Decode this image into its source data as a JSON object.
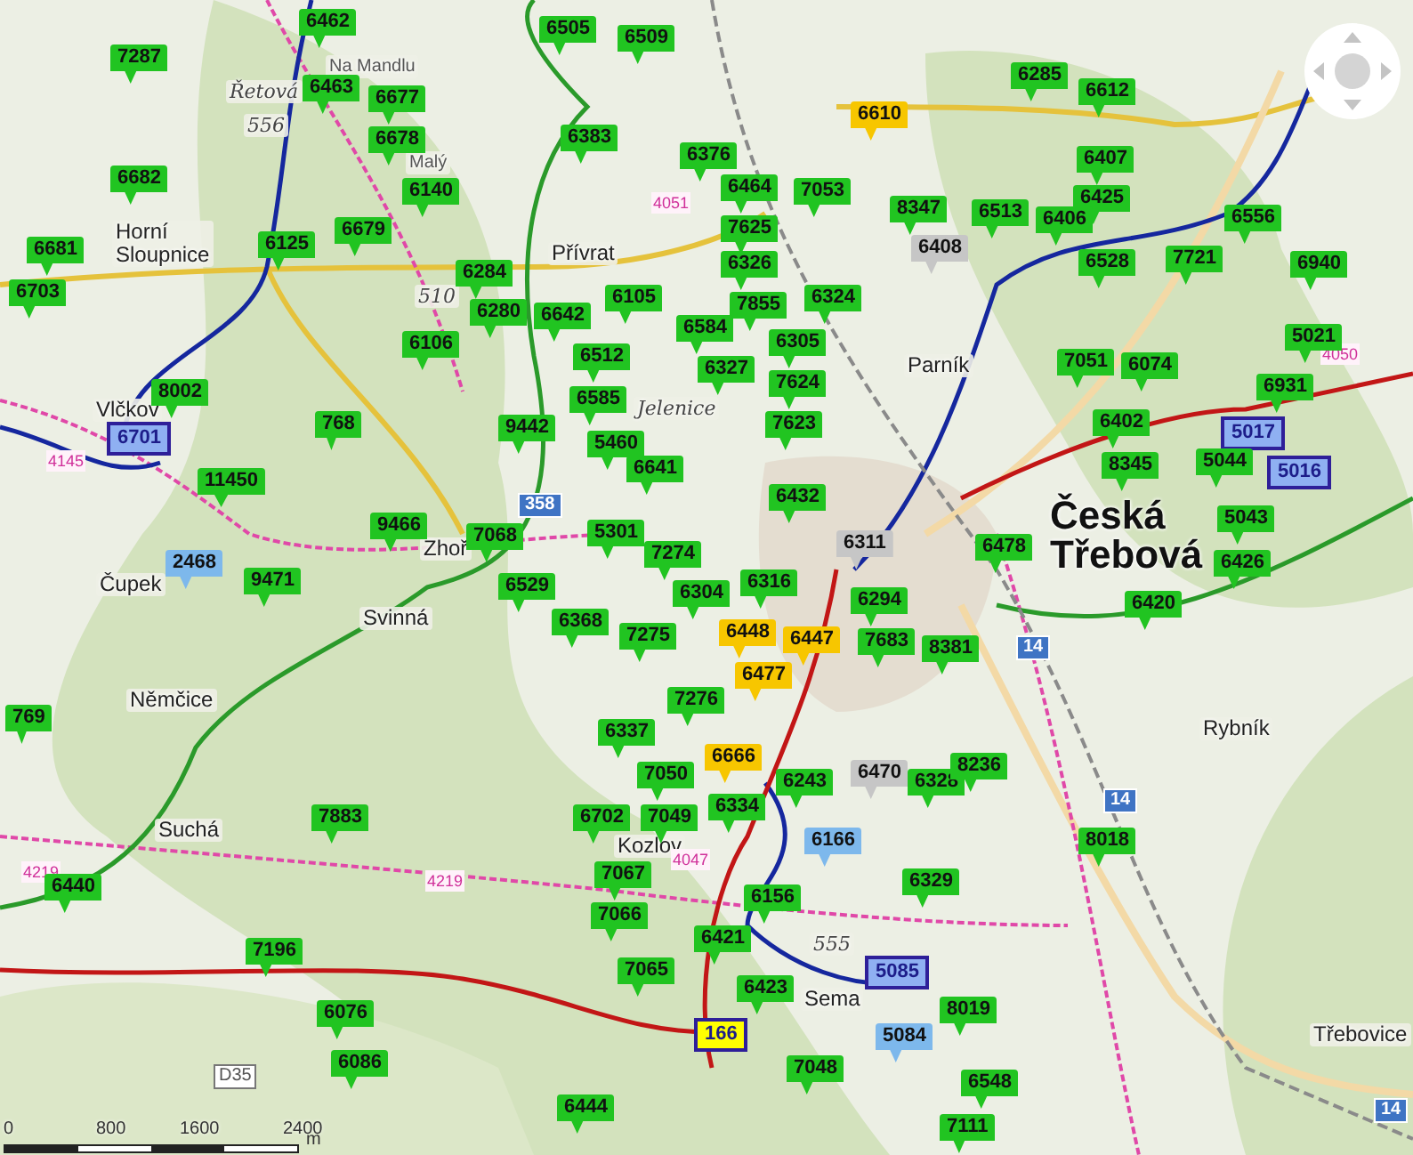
{
  "map": {
    "markers": [
      {
        "label": "6462",
        "color": "#21c421",
        "kind": "pin"
      },
      {
        "label": "7287",
        "color": "#21c421",
        "kind": "pin"
      },
      {
        "label": "6463",
        "color": "#21c421",
        "kind": "pin"
      },
      {
        "label": "6677",
        "color": "#21c421",
        "kind": "pin"
      },
      {
        "label": "6678",
        "color": "#21c421",
        "kind": "pin"
      },
      {
        "label": "6682",
        "color": "#21c421",
        "kind": "pin"
      },
      {
        "label": "6140",
        "color": "#21c421",
        "kind": "pin"
      },
      {
        "label": "6679",
        "color": "#21c421",
        "kind": "pin"
      },
      {
        "label": "6681",
        "color": "#21c421",
        "kind": "pin"
      },
      {
        "label": "6125",
        "color": "#21c421",
        "kind": "pin"
      },
      {
        "label": "6703",
        "color": "#21c421",
        "kind": "pin"
      },
      {
        "label": "6284",
        "color": "#21c421",
        "kind": "pin"
      },
      {
        "label": "6280",
        "color": "#21c421",
        "kind": "pin"
      },
      {
        "label": "6106",
        "color": "#21c421",
        "kind": "pin"
      },
      {
        "label": "8002",
        "color": "#21c421",
        "kind": "pin"
      },
      {
        "label": "6701",
        "color": "#8fb0f2",
        "kind": "framed"
      },
      {
        "label": "768",
        "color": "#21c421",
        "kind": "pin"
      },
      {
        "label": "11450",
        "color": "#21c421",
        "kind": "pin"
      },
      {
        "label": "9466",
        "color": "#21c421",
        "kind": "pin"
      },
      {
        "label": "2468",
        "color": "#7db8ec",
        "kind": "pin"
      },
      {
        "label": "9471",
        "color": "#21c421",
        "kind": "pin"
      },
      {
        "label": "6505",
        "color": "#21c421",
        "kind": "pin"
      },
      {
        "label": "6509",
        "color": "#21c421",
        "kind": "pin"
      },
      {
        "label": "6383",
        "color": "#21c421",
        "kind": "pin"
      },
      {
        "label": "6376",
        "color": "#21c421",
        "kind": "pin"
      },
      {
        "label": "6464",
        "color": "#21c421",
        "kind": "pin"
      },
      {
        "label": "7053",
        "color": "#21c421",
        "kind": "pin"
      },
      {
        "label": "7625",
        "color": "#21c421",
        "kind": "pin"
      },
      {
        "label": "6326",
        "color": "#21c421",
        "kind": "pin"
      },
      {
        "label": "7855",
        "color": "#21c421",
        "kind": "pin"
      },
      {
        "label": "6105",
        "color": "#21c421",
        "kind": "pin"
      },
      {
        "label": "6324",
        "color": "#21c421",
        "kind": "pin"
      },
      {
        "label": "6642",
        "color": "#21c421",
        "kind": "pin"
      },
      {
        "label": "6584",
        "color": "#21c421",
        "kind": "pin"
      },
      {
        "label": "6305",
        "color": "#21c421",
        "kind": "pin"
      },
      {
        "label": "6512",
        "color": "#21c421",
        "kind": "pin"
      },
      {
        "label": "6327",
        "color": "#21c421",
        "kind": "pin"
      },
      {
        "label": "7624",
        "color": "#21c421",
        "kind": "pin"
      },
      {
        "label": "7623",
        "color": "#21c421",
        "kind": "pin"
      },
      {
        "label": "6585",
        "color": "#21c421",
        "kind": "pin"
      },
      {
        "label": "9442",
        "color": "#21c421",
        "kind": "pin"
      },
      {
        "label": "5460",
        "color": "#21c421",
        "kind": "pin"
      },
      {
        "label": "6641",
        "color": "#21c421",
        "kind": "pin"
      },
      {
        "label": "6432",
        "color": "#21c421",
        "kind": "pin"
      },
      {
        "label": "7068",
        "color": "#21c421",
        "kind": "pin"
      },
      {
        "label": "5301",
        "color": "#21c421",
        "kind": "pin"
      },
      {
        "label": "6311",
        "color": "#c6c6c6",
        "kind": "pin"
      },
      {
        "label": "7274",
        "color": "#21c421",
        "kind": "pin"
      },
      {
        "label": "6529",
        "color": "#21c421",
        "kind": "pin"
      },
      {
        "label": "6304",
        "color": "#21c421",
        "kind": "pin"
      },
      {
        "label": "6316",
        "color": "#21c421",
        "kind": "pin"
      },
      {
        "label": "6368",
        "color": "#21c421",
        "kind": "pin"
      },
      {
        "label": "7275",
        "color": "#21c421",
        "kind": "pin"
      },
      {
        "label": "6448",
        "color": "#f7c600",
        "kind": "pin"
      },
      {
        "label": "6447",
        "color": "#f7c600",
        "kind": "pin"
      },
      {
        "label": "6294",
        "color": "#21c421",
        "kind": "pin"
      },
      {
        "label": "7683",
        "color": "#21c421",
        "kind": "pin"
      },
      {
        "label": "6477",
        "color": "#f7c600",
        "kind": "pin"
      },
      {
        "label": "7276",
        "color": "#21c421",
        "kind": "pin"
      },
      {
        "label": "8381",
        "color": "#21c421",
        "kind": "pin"
      },
      {
        "label": "6337",
        "color": "#21c421",
        "kind": "pin"
      },
      {
        "label": "7050",
        "color": "#21c421",
        "kind": "pin"
      },
      {
        "label": "6666",
        "color": "#f7c600",
        "kind": "pin"
      },
      {
        "label": "6702",
        "color": "#21c421",
        "kind": "pin"
      },
      {
        "label": "7049",
        "color": "#21c421",
        "kind": "pin"
      },
      {
        "label": "6334",
        "color": "#21c421",
        "kind": "pin"
      },
      {
        "label": "6243",
        "color": "#21c421",
        "kind": "pin"
      },
      {
        "label": "6470",
        "color": "#c6c6c6",
        "kind": "pin"
      },
      {
        "label": "6328",
        "color": "#21c421",
        "kind": "pin"
      },
      {
        "label": "6166",
        "color": "#7db8ec",
        "kind": "pin"
      },
      {
        "label": "7067",
        "color": "#21c421",
        "kind": "pin"
      },
      {
        "label": "6329",
        "color": "#21c421",
        "kind": "pin"
      },
      {
        "label": "6156",
        "color": "#21c421",
        "kind": "pin"
      },
      {
        "label": "7066",
        "color": "#21c421",
        "kind": "pin"
      },
      {
        "label": "6421",
        "color": "#21c421",
        "kind": "pin"
      },
      {
        "label": "7065",
        "color": "#21c421",
        "kind": "pin"
      },
      {
        "label": "5085",
        "color": "#8fb0f2",
        "kind": "framed"
      },
      {
        "label": "6423",
        "color": "#21c421",
        "kind": "pin"
      },
      {
        "label": "166",
        "color": "#ffff00",
        "kind": "framed"
      },
      {
        "label": "5084",
        "color": "#7db8ec",
        "kind": "pin"
      },
      {
        "label": "8019",
        "color": "#21c421",
        "kind": "pin"
      },
      {
        "label": "7048",
        "color": "#21c421",
        "kind": "pin"
      },
      {
        "label": "6444",
        "color": "#21c421",
        "kind": "pin"
      },
      {
        "label": "6548",
        "color": "#21c421",
        "kind": "pin"
      },
      {
        "label": "7111",
        "color": "#21c421",
        "kind": "pin"
      },
      {
        "label": "6610",
        "color": "#f7c600",
        "kind": "pin"
      },
      {
        "label": "6285",
        "color": "#21c421",
        "kind": "pin"
      },
      {
        "label": "6612",
        "color": "#21c421",
        "kind": "pin"
      },
      {
        "label": "6407",
        "color": "#21c421",
        "kind": "pin"
      },
      {
        "label": "6425",
        "color": "#21c421",
        "kind": "pin"
      },
      {
        "label": "8347",
        "color": "#21c421",
        "kind": "pin"
      },
      {
        "label": "6408",
        "color": "#c6c6c6",
        "kind": "pin"
      },
      {
        "label": "6513",
        "color": "#21c421",
        "kind": "pin"
      },
      {
        "label": "6406",
        "color": "#21c421",
        "kind": "pin"
      },
      {
        "label": "6556",
        "color": "#21c421",
        "kind": "pin"
      },
      {
        "label": "6528",
        "color": "#21c421",
        "kind": "pin"
      },
      {
        "label": "7721",
        "color": "#21c421",
        "kind": "pin"
      },
      {
        "label": "6940",
        "color": "#21c421",
        "kind": "pin"
      },
      {
        "label": "5021",
        "color": "#21c421",
        "kind": "pin"
      },
      {
        "label": "7051",
        "color": "#21c421",
        "kind": "pin"
      },
      {
        "label": "6074",
        "color": "#21c421",
        "kind": "pin"
      },
      {
        "label": "6931",
        "color": "#21c421",
        "kind": "pin"
      },
      {
        "label": "6402",
        "color": "#21c421",
        "kind": "pin"
      },
      {
        "label": "5017",
        "color": "#8fb0f2",
        "kind": "framed"
      },
      {
        "label": "5044",
        "color": "#21c421",
        "kind": "pin"
      },
      {
        "label": "5016",
        "color": "#8fb0f2",
        "kind": "framed"
      },
      {
        "label": "8345",
        "color": "#21c421",
        "kind": "pin"
      },
      {
        "label": "5043",
        "color": "#21c421",
        "kind": "pin"
      },
      {
        "label": "6420",
        "color": "#21c421",
        "kind": "pin"
      },
      {
        "label": "6426",
        "color": "#21c421",
        "kind": "pin"
      },
      {
        "label": "6478",
        "color": "#21c421",
        "kind": "pin"
      },
      {
        "label": "8236",
        "color": "#21c421",
        "kind": "pin"
      },
      {
        "label": "8018",
        "color": "#21c421",
        "kind": "pin"
      },
      {
        "label": "769",
        "color": "#21c421",
        "kind": "pin"
      },
      {
        "label": "7883",
        "color": "#21c421",
        "kind": "pin"
      },
      {
        "label": "6440",
        "color": "#21c421",
        "kind": "pin"
      },
      {
        "label": "7196",
        "color": "#21c421",
        "kind": "pin"
      },
      {
        "label": "6076",
        "color": "#21c421",
        "kind": "pin"
      },
      {
        "label": "6086",
        "color": "#21c421",
        "kind": "pin"
      }
    ],
    "places": [
      {
        "name": "Řetová",
        "kind": "peak"
      },
      {
        "name": "556",
        "kind": "peak"
      },
      {
        "name": "Na Mandlu",
        "kind": "locality"
      },
      {
        "name": "Horní Sloupnice",
        "kind": "village"
      },
      {
        "name": "Malý",
        "kind": "locality"
      },
      {
        "name": "510",
        "kind": "peak"
      },
      {
        "name": "Přívrat",
        "kind": "village"
      },
      {
        "name": "Jelenice",
        "kind": "peak"
      },
      {
        "name": "Parník",
        "kind": "village"
      },
      {
        "name": "Vlčkov",
        "kind": "village"
      },
      {
        "name": "Zhoř",
        "kind": "village"
      },
      {
        "name": "Čupek",
        "kind": "village"
      },
      {
        "name": "Svinná",
        "kind": "village"
      },
      {
        "name": "Němčice",
        "kind": "village"
      },
      {
        "name": "Suchá",
        "kind": "village"
      },
      {
        "name": "Kozlov",
        "kind": "village"
      },
      {
        "name": "555",
        "kind": "peak"
      },
      {
        "name": "Sema",
        "kind": "village"
      },
      {
        "name": "Rybník",
        "kind": "village"
      },
      {
        "name": "Třebovice",
        "kind": "village"
      },
      {
        "name": "Česká Třebová",
        "kind": "city"
      }
    ],
    "road_numbers": [
      {
        "label": "358",
        "kind": "road"
      },
      {
        "label": "14",
        "kind": "road"
      },
      {
        "label": "14",
        "kind": "road"
      },
      {
        "label": "14",
        "kind": "road"
      },
      {
        "label": "D35",
        "kind": "motorway"
      },
      {
        "label": "4051",
        "kind": "regional"
      },
      {
        "label": "4145",
        "kind": "regional"
      },
      {
        "label": "4219",
        "kind": "regional"
      },
      {
        "label": "4219",
        "kind": "regional"
      },
      {
        "label": "4050",
        "kind": "regional"
      },
      {
        "label": "4047",
        "kind": "regional"
      }
    ],
    "scale": {
      "ticks": [
        "0",
        "800",
        "1600",
        "2400"
      ],
      "unit": "m"
    }
  }
}
